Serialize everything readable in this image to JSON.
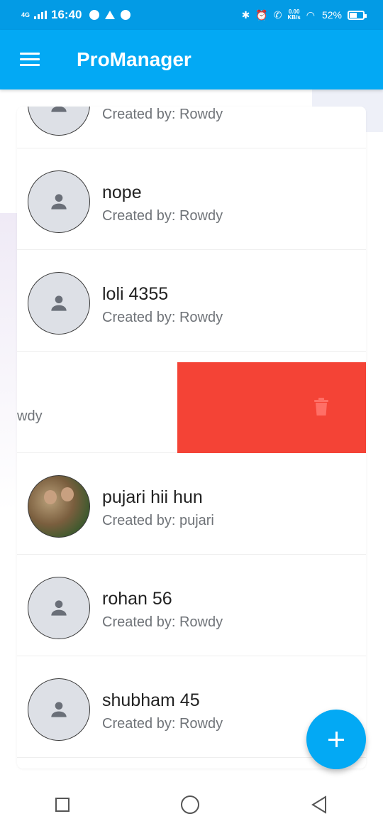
{
  "status_bar": {
    "network": "4G",
    "time": "16:40",
    "speed_value": "0.00",
    "speed_unit": "KB/s",
    "battery": "52%"
  },
  "app_bar": {
    "title": "ProManager",
    "menu_icon": "hamburger-menu-icon"
  },
  "list": {
    "items": [
      {
        "title": "",
        "subtitle": "Created by: Rowdy",
        "avatar": "person-icon"
      },
      {
        "title": "nope",
        "subtitle": "Created by: Rowdy",
        "avatar": "person-icon"
      },
      {
        "title": "loli 4355",
        "subtitle": "Created by: Rowdy",
        "avatar": "person-icon"
      },
      {
        "title": "",
        "subtitle": "wdy",
        "avatar": "",
        "swipe_action_icon": "trash-icon"
      },
      {
        "title": "pujari hii hun",
        "subtitle": "Created by: pujari",
        "avatar": "photo"
      },
      {
        "title": "rohan 56",
        "subtitle": "Created by: Rowdy",
        "avatar": "person-icon"
      },
      {
        "title": "shubham 45",
        "subtitle": "Created by: Rowdy",
        "avatar": "person-icon"
      }
    ]
  },
  "fab": {
    "icon": "plus-icon"
  },
  "colors": {
    "primary": "#03a9f4",
    "status_bar": "#039be5",
    "delete": "#f44336",
    "avatar_bg": "#dde0e6",
    "subtitle": "#6f7378"
  },
  "nav_bar": {
    "recent_icon": "square-icon",
    "home_icon": "circle-icon",
    "back_icon": "triangle-back-icon"
  }
}
